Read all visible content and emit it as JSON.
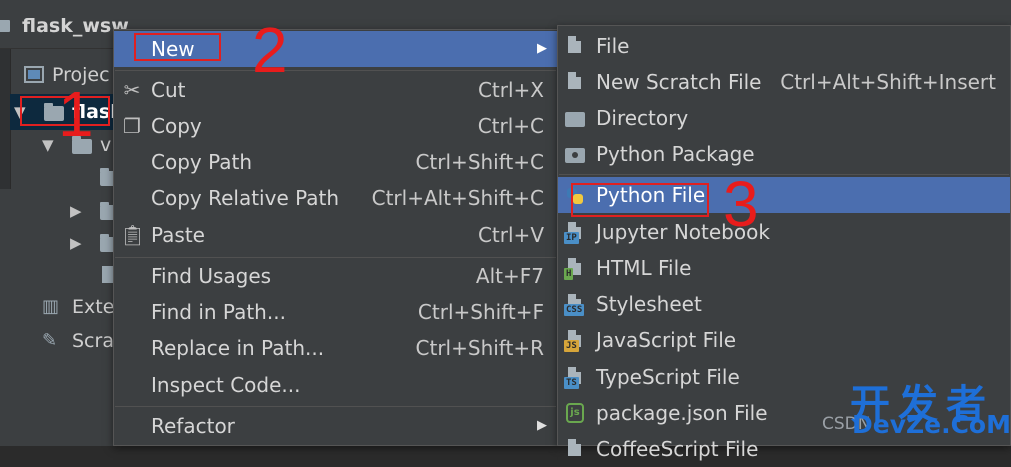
{
  "project": {
    "title": "flask_wsw",
    "tree": {
      "project_label": "Projec",
      "selected_folder": "flask",
      "sub_folder": "v",
      "external": "Exte",
      "scratches": "Scra"
    }
  },
  "context_menu": {
    "items": [
      {
        "label": "New",
        "shortcut": "",
        "icon": "",
        "submenu": true
      },
      {
        "label": "Cut",
        "shortcut": "Ctrl+X",
        "icon": "scissors-icon"
      },
      {
        "label": "Copy",
        "shortcut": "Ctrl+C",
        "icon": "copy-icon"
      },
      {
        "label": "Copy Path",
        "shortcut": "Ctrl+Shift+C",
        "icon": ""
      },
      {
        "label": "Copy Relative Path",
        "shortcut": "Ctrl+Alt+Shift+C",
        "icon": ""
      },
      {
        "label": "Paste",
        "shortcut": "Ctrl+V",
        "icon": "clipboard-icon"
      },
      {
        "label": "Find Usages",
        "shortcut": "Alt+F7",
        "icon": ""
      },
      {
        "label": "Find in Path...",
        "shortcut": "Ctrl+Shift+F",
        "icon": ""
      },
      {
        "label": "Replace in Path...",
        "shortcut": "Ctrl+Shift+R",
        "icon": ""
      },
      {
        "label": "Inspect Code...",
        "shortcut": "",
        "icon": ""
      },
      {
        "label": "Refactor",
        "shortcut": "",
        "icon": "",
        "submenu": true
      }
    ],
    "submenu_arrow": "▶"
  },
  "new_submenu": {
    "items": [
      {
        "label": "File",
        "shortcut": "",
        "icon": "file-icon"
      },
      {
        "label": "New Scratch File",
        "shortcut": "Ctrl+Alt+Shift+Insert",
        "icon": "scratch-file-icon"
      },
      {
        "label": "Directory",
        "shortcut": "",
        "icon": "directory-icon"
      },
      {
        "label": "Python Package",
        "shortcut": "",
        "icon": "python-package-icon"
      },
      {
        "label": "Python File",
        "shortcut": "",
        "icon": "python-file-icon"
      },
      {
        "label": "Jupyter Notebook",
        "shortcut": "",
        "icon": "jupyter-icon",
        "badge": "IP",
        "badge_color": "#4a8fc7"
      },
      {
        "label": "HTML File",
        "shortcut": "",
        "icon": "html-icon",
        "badge": "H",
        "badge_color": "#6aa84f"
      },
      {
        "label": "Stylesheet",
        "shortcut": "",
        "icon": "css-icon",
        "badge": "CSS",
        "badge_color": "#4a8fc7"
      },
      {
        "label": "JavaScript File",
        "shortcut": "",
        "icon": "javascript-icon",
        "badge": "JS",
        "badge_color": "#d6a53a"
      },
      {
        "label": "TypeScript File",
        "shortcut": "",
        "icon": "typescript-icon",
        "badge": "TS",
        "badge_color": "#4a8fc7"
      },
      {
        "label": "package.json File",
        "shortcut": "",
        "icon": "nodejs-icon"
      },
      {
        "label": "CoffeeScript File",
        "shortcut": "",
        "icon": "coffeescript-icon"
      }
    ]
  },
  "annotations": {
    "numbers": [
      "1",
      "2",
      "3"
    ],
    "color": "#e02020"
  },
  "watermark": {
    "chinese": "开发者",
    "csdn": "CSDN",
    "domain": "DevZe.CoM"
  },
  "colors": {
    "menu_bg": "#3c3f41",
    "highlight": "#4b6eaf",
    "selection": "#0d293e"
  }
}
